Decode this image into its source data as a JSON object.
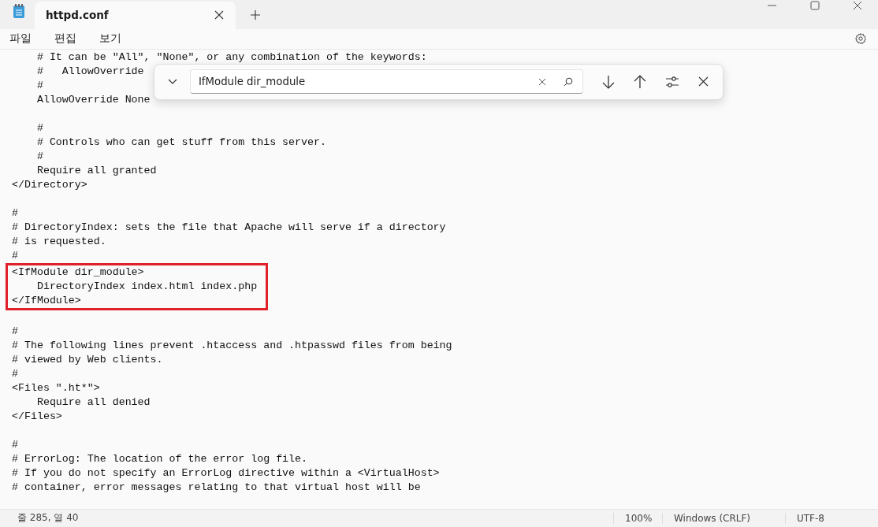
{
  "tabs": [
    {
      "label": "httpd.conf",
      "selected": true
    }
  ],
  "menu": [
    "파일",
    "편집",
    "보기"
  ],
  "editor": {
    "blocks": [
      {
        "lines": [
          "    # It can be \"All\", \"None\", or any combination of the keywords:",
          "    #   AllowOverride",
          "    #",
          "    AllowOverride None"
        ]
      },
      {
        "lines": [
          "    #",
          "    # Controls who can get stuff from this server.",
          "    #",
          "    Require all granted",
          "</Directory>"
        ]
      },
      {
        "lines": [
          "#",
          "# DirectoryIndex: sets the file that Apache will serve if a directory",
          "# is requested.",
          "#"
        ],
        "highlighted_lines": [
          "<IfModule dir_module>",
          "    DirectoryIndex index.html index.php",
          "</IfModule>"
        ]
      },
      {
        "lines": [
          "#",
          "# The following lines prevent .htaccess and .htpasswd files from being",
          "# viewed by Web clients.",
          "#",
          "<Files \".ht*\">",
          "    Require all denied",
          "</Files>"
        ]
      },
      {
        "lines": [
          "#",
          "# ErrorLog: The location of the error log file.",
          "# If you do not specify an ErrorLog directive within a <VirtualHost>",
          "# container, error messages relating to that virtual host will be"
        ]
      }
    ]
  },
  "find": {
    "value": "IfModule dir_module"
  },
  "status_bar": {
    "position": "줄 285, 열 40",
    "zoom": "100%",
    "line_ending": "Windows (CRLF)",
    "encoding": "UTF-8"
  }
}
